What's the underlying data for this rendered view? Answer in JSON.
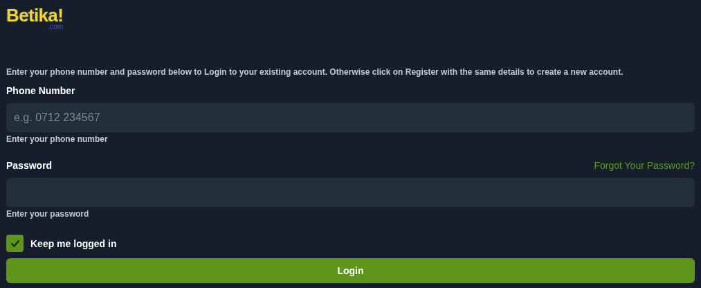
{
  "logo": {
    "brand": "Betika!",
    "domain": ".com"
  },
  "intro": "Enter your phone number and password below to Login to your existing account. Otherwise click on Register with the same details to create a new account.",
  "phone": {
    "label": "Phone Number",
    "placeholder": "e.g. 0712 234567",
    "hint": "Enter your phone number"
  },
  "password": {
    "label": "Password",
    "forgot_link": "Forgot Your Password?",
    "hint": "Enter your password"
  },
  "keep_logged_in": {
    "label": "Keep me logged in",
    "checked": true
  },
  "login_button": "Login"
}
